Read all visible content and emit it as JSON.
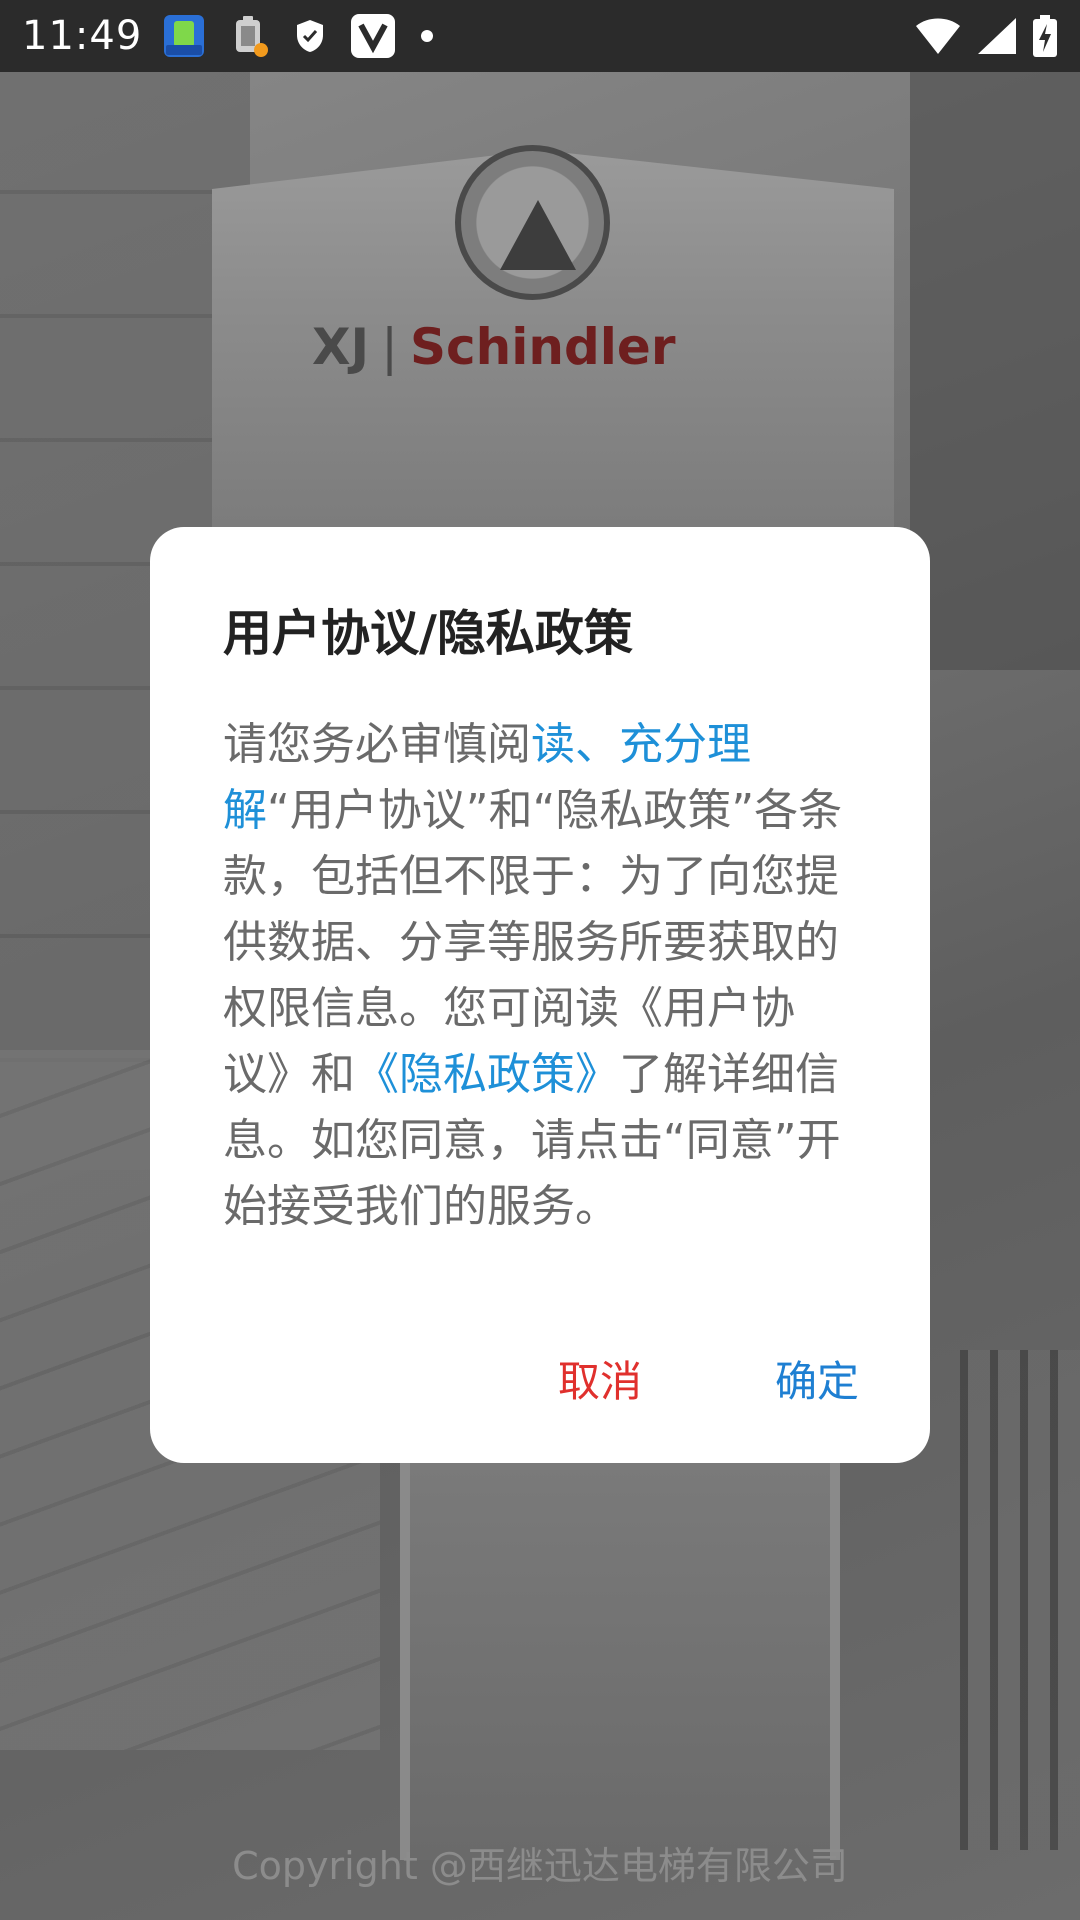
{
  "status_bar": {
    "time": "11:49",
    "icons_left": [
      "app-notification-icon",
      "battery-alert-icon",
      "shield-icon",
      "vpn-v-icon",
      "dot-icon"
    ],
    "icons_right": [
      "wifi-icon",
      "signal-icon",
      "battery-charging-icon"
    ]
  },
  "splash": {
    "logo": {
      "prefix": "XJ",
      "separator": "|",
      "brand": "Schindler"
    },
    "copyright": "Copyright @西继迅达电梯有限公司"
  },
  "dialog": {
    "title": "用户协议/隐私政策",
    "body": {
      "part1": "请您务必审慎阅",
      "link1": "读、充分理解",
      "part2": "“用户协议”和“隐私政策”各条款，包括但不限于：为了向您提供数据、分享等服务所要获取的权限信息。您可阅读《用户协议》和",
      "link2": "《隐私政策》",
      "part3": "了解详细信息。如您同意，请点击“同意”开始接受我们的服务。"
    },
    "cancel_label": "取消",
    "confirm_label": "确定"
  },
  "colors": {
    "link": "#1e90d8",
    "cancel": "#e0302d",
    "confirm": "#1e7fd2",
    "title": "#222222",
    "body_text": "#6a6a6a",
    "logo_brand": "#6e1f1f"
  }
}
